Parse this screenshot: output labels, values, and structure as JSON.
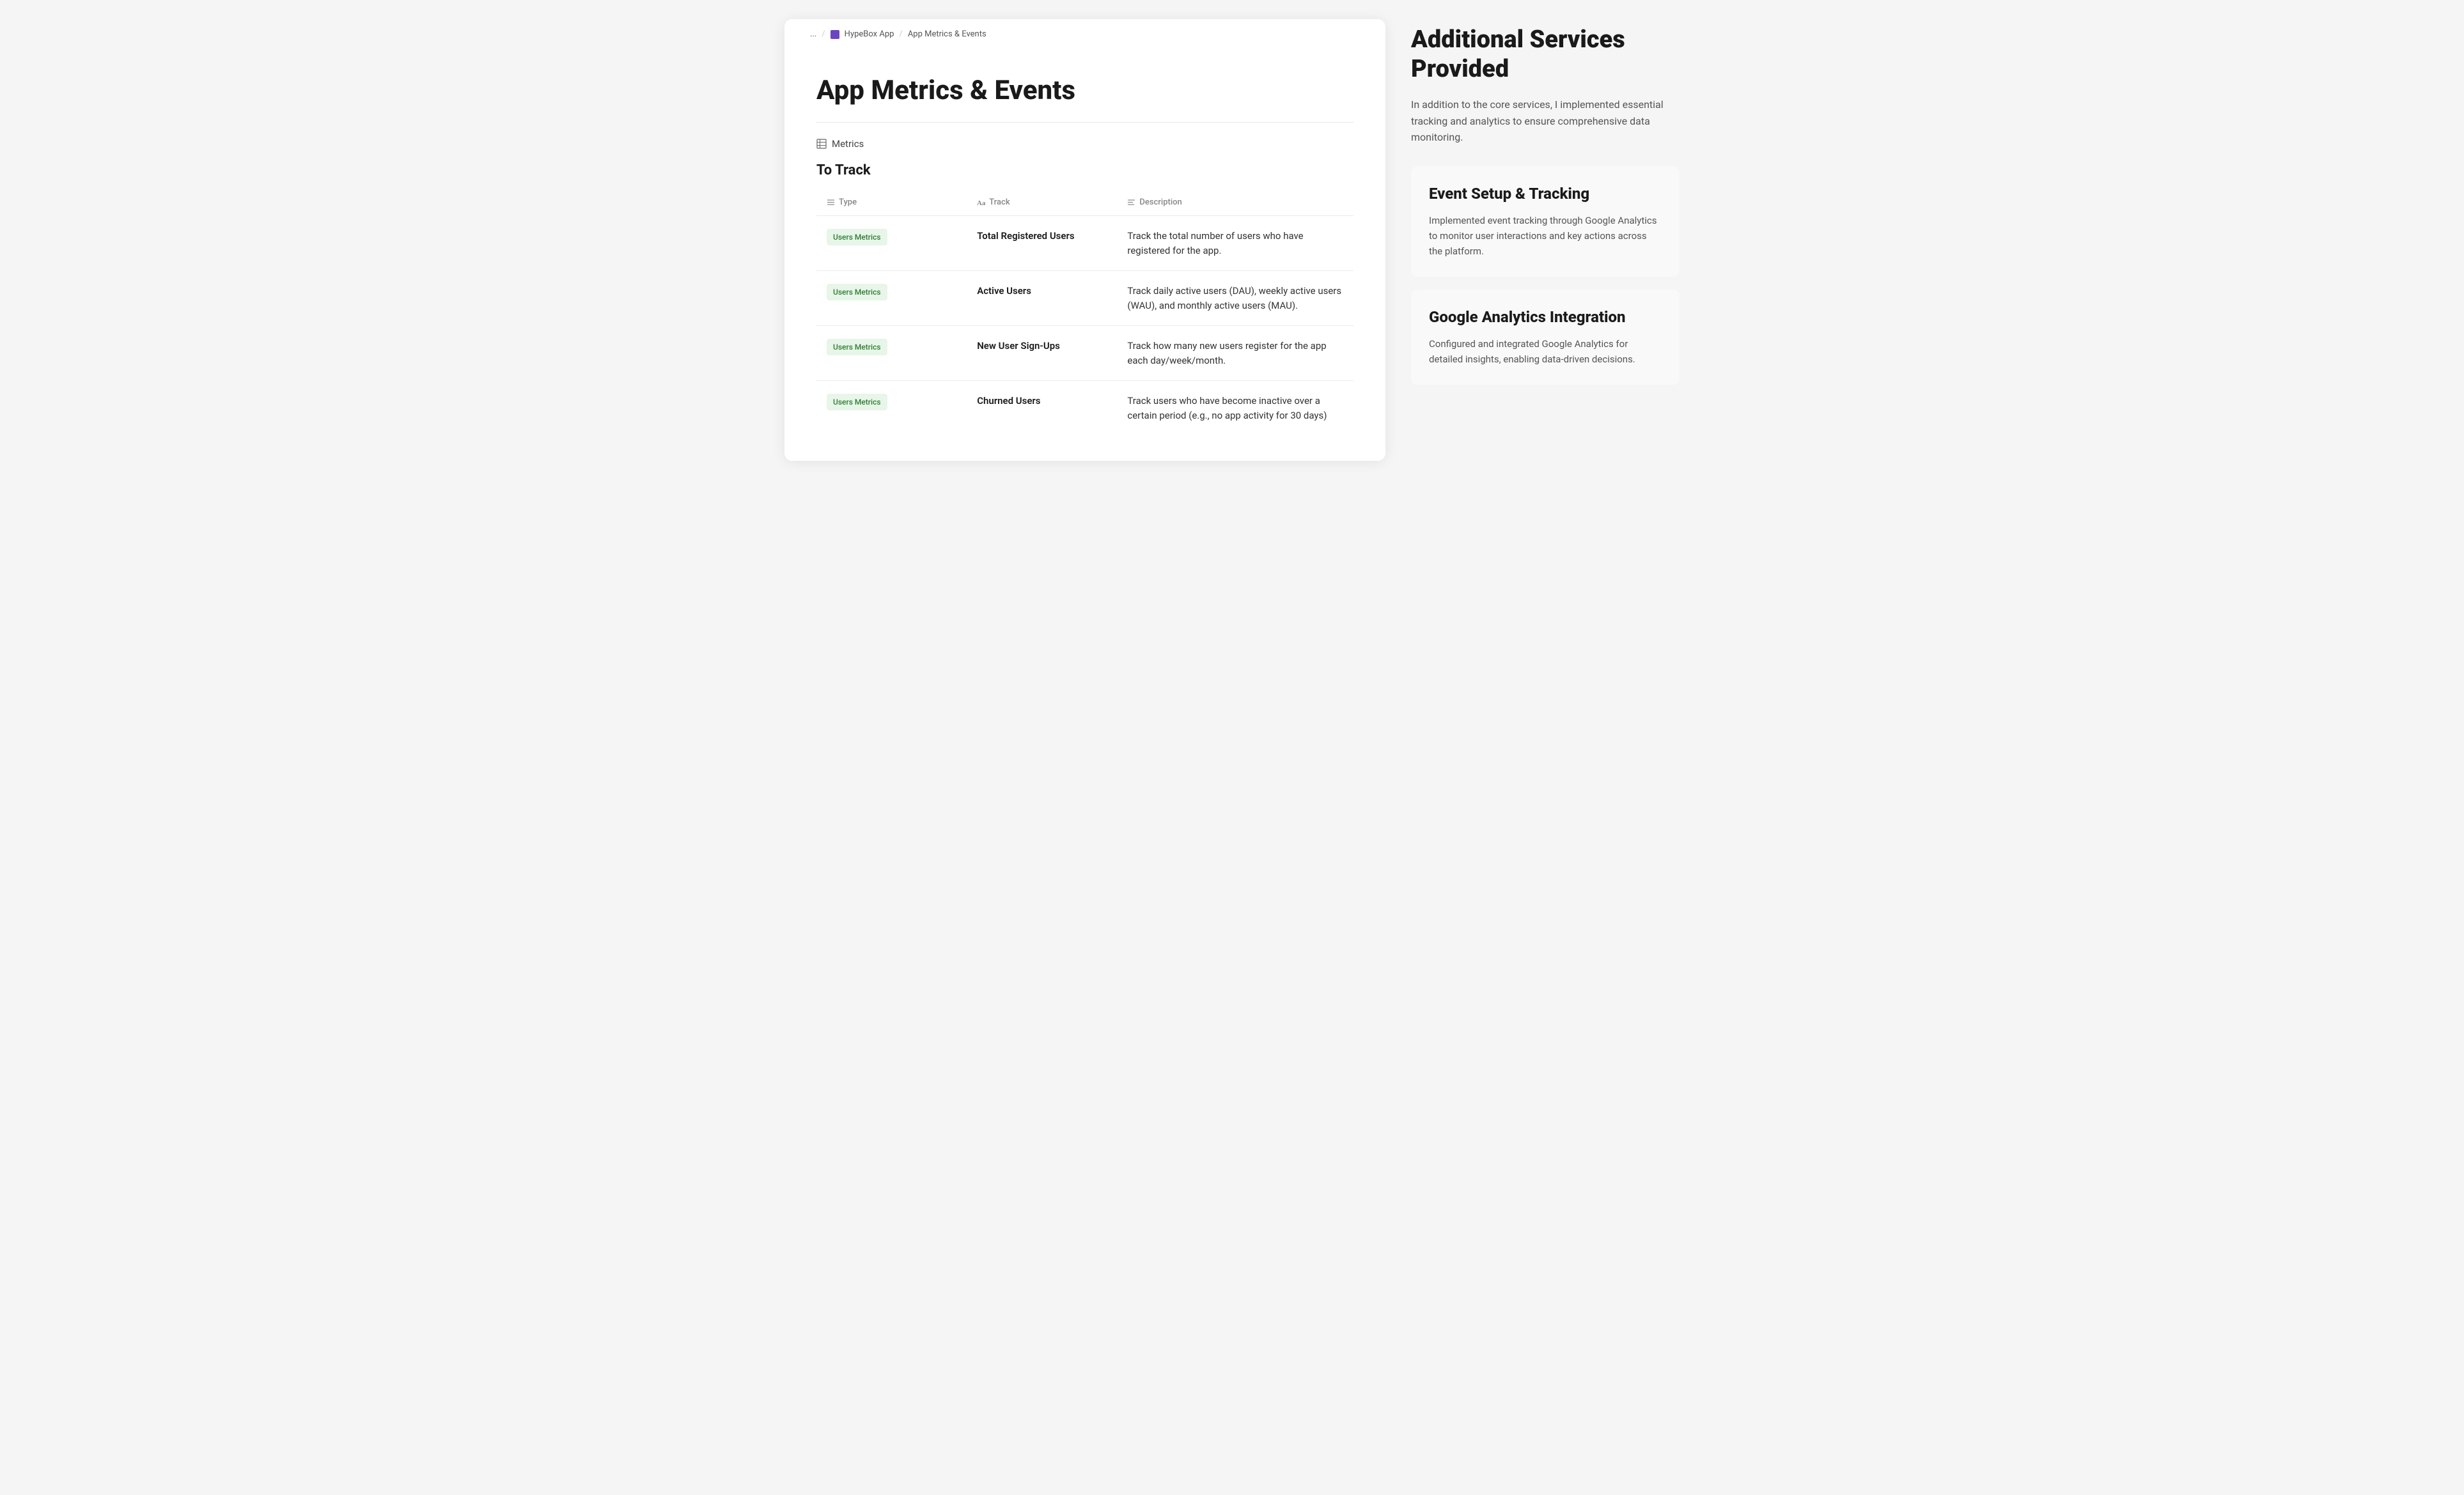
{
  "breadcrumb": {
    "ellipsis": "...",
    "separator1": "/",
    "app_icon_label": "HypeBox App Icon",
    "app_name": "HypeBox App",
    "separator2": "/",
    "current_page": "App Metrics & Events"
  },
  "document": {
    "title": "App Metrics & Events",
    "metrics_section_label": "Metrics",
    "to_track_heading": "To Track",
    "table": {
      "columns": [
        {
          "id": "type",
          "label": "Type",
          "icon": "list-icon"
        },
        {
          "id": "track",
          "label": "Track",
          "icon": "text-icon"
        },
        {
          "id": "description",
          "label": "Description",
          "icon": "align-left-icon"
        }
      ],
      "rows": [
        {
          "type": "Users Metrics",
          "track": "Total Registered Users",
          "description": "Track the total number of users who have registered for the app."
        },
        {
          "type": "Users Metrics",
          "track": "Active Users",
          "description": "Track daily active users (DAU), weekly active users (WAU), and monthly active users (MAU)."
        },
        {
          "type": "Users Metrics",
          "track": "New User Sign-Ups",
          "description": "Track how many new users register for the app each day/week/month."
        },
        {
          "type": "Users Metrics",
          "track": "Churned Users",
          "description": "Track users who have become inactive over a certain period (e.g., no app activity for 30 days)"
        }
      ]
    }
  },
  "services": {
    "main_title": "Additional Services Provided",
    "intro": "In addition to the core services, I implemented essential tracking and analytics to ensure comprehensive data monitoring.",
    "cards": [
      {
        "title": "Event Setup & Tracking",
        "description": "Implemented event tracking through Google Analytics to monitor user interactions and key actions across the platform."
      },
      {
        "title": "Google Analytics Integration",
        "description": "Configured and integrated Google Analytics for detailed insights, enabling data-driven decisions."
      }
    ]
  }
}
